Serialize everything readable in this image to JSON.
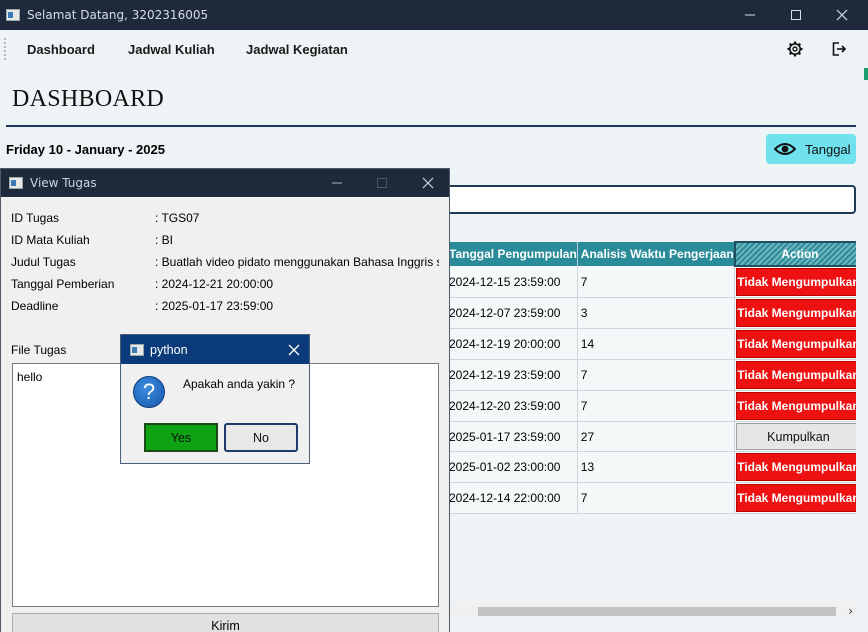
{
  "window": {
    "title": "Selamat Datang, 3202316005"
  },
  "nav": {
    "items": [
      "Dashboard",
      "Jadwal Kuliah",
      "Jadwal Kegiatan"
    ],
    "icons": [
      "gear-icon",
      "logout-icon"
    ]
  },
  "page": {
    "title": "DASHBOARD",
    "date": "Friday 10 - January - 2025",
    "tanggal_button": "Tanggal"
  },
  "search": {
    "value": ""
  },
  "table": {
    "headers": [
      "Tanggal Pengumpulan",
      "Analisis Waktu Pengerjaan",
      "Action"
    ],
    "rows": [
      {
        "tanggal": "2024-12-15 23:59:00",
        "analisis": "7",
        "action": "Tidak Mengumpulkan",
        "status": "red"
      },
      {
        "tanggal": "2024-12-07 23:59:00",
        "analisis": "3",
        "action": "Tidak Mengumpulkan",
        "status": "red"
      },
      {
        "tanggal": "2024-12-19 20:00:00",
        "analisis": "14",
        "action": "Tidak Mengumpulkan",
        "status": "red"
      },
      {
        "tanggal": "2024-12-19 23:59:00",
        "analisis": "7",
        "action": "Tidak Mengumpulkan",
        "status": "red"
      },
      {
        "tanggal": "2024-12-20 23:59:00",
        "analisis": "7",
        "action": "Tidak Mengumpulkan",
        "status": "red"
      },
      {
        "tanggal": "2025-01-17 23:59:00",
        "analisis": "27",
        "action": "Kumpulkan",
        "status": "button"
      },
      {
        "tanggal": "2025-01-02 23:00:00",
        "analisis": "13",
        "action": "Tidak Mengumpulkan",
        "status": "red"
      },
      {
        "tanggal": "2024-12-14 22:00:00",
        "analisis": "7",
        "action": "Tidak Mengumpulkan",
        "status": "red"
      }
    ]
  },
  "view_tugas": {
    "title": "View Tugas",
    "fields": [
      {
        "label": "ID Tugas",
        "value": ": TGS07"
      },
      {
        "label": "ID Mata Kuliah",
        "value": ": BI"
      },
      {
        "label": "Judul Tugas",
        "value": ": Buatlah video pidato menggunakan Bahasa Inggris se"
      },
      {
        "label": "Tanggal Pemberian",
        "value": ": 2024-12-21 20:00:00"
      },
      {
        "label": "Deadline",
        "value": ": 2025-01-17 23:59:00"
      }
    ],
    "file_label": "File Tugas",
    "file_content": "hello",
    "submit_label": "Kirim"
  },
  "dialog": {
    "title": "python",
    "message": "Apakah anda yakin ?",
    "yes_label": "Yes",
    "no_label": "No"
  },
  "colors": {
    "titlebar": "#1e2a3c",
    "header_teal": "#2b8c99",
    "status_red": "#ee1111",
    "accent_cyan": "#6fe2ee",
    "yes_green": "#0fa314",
    "dialog_title": "#0a3a7a"
  }
}
